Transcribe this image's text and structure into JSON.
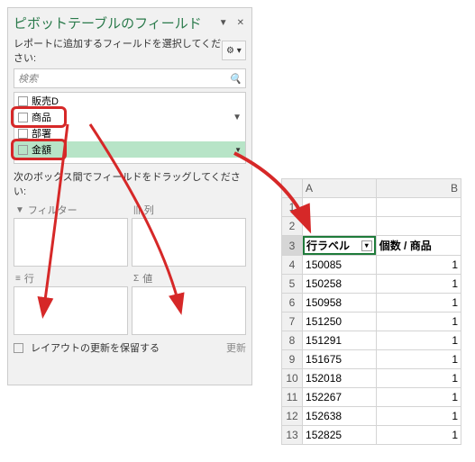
{
  "panel": {
    "title": "ピボットテーブルのフィールド",
    "subtitle": "レポートに追加するフィールドを選択してください:",
    "search_placeholder": "検索",
    "fields": {
      "f0": "販売D",
      "f1": "商品",
      "f2": "部署",
      "f3": "金額"
    },
    "drag_label": "次のボックス間でフィールドをドラッグしてください:",
    "areas": {
      "filter": "フィルター",
      "column": "列",
      "row": "行",
      "value": "値"
    },
    "footer": {
      "defer_label": "レイアウトの更新を保留する",
      "update_btn": "更新"
    }
  },
  "sheet": {
    "colA": "A",
    "colB": "B",
    "row_label_header": "行ラベル",
    "count_header": "個数 / 商品",
    "rows": {
      "r4a": "150085",
      "r4b": "1",
      "r5a": "150258",
      "r5b": "1",
      "r6a": "150958",
      "r6b": "1",
      "r7a": "151250",
      "r7b": "1",
      "r8a": "151291",
      "r8b": "1",
      "r9a": "151675",
      "r9b": "1",
      "r10a": "152018",
      "r10b": "1",
      "r11a": "152267",
      "r11b": "1",
      "r12a": "152638",
      "r12b": "1",
      "r13a": "152825",
      "r13b": "1"
    }
  }
}
